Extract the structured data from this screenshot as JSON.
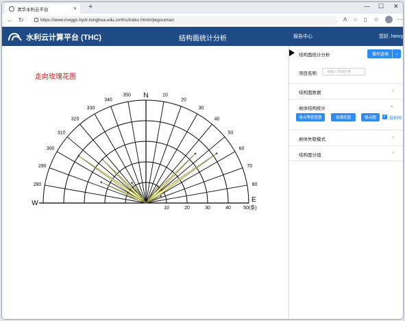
{
  "browser": {
    "tab_title": "清华水利云平台",
    "url": "https://www.meggs.hydr.tsinghua.edu.cn/thc/index.html#/jiegoumian"
  },
  "header": {
    "brand": "水利云计算平台 (THC)",
    "page_title": "结构面统计分析",
    "report_center": "报告中心",
    "greeting": "您好, henry"
  },
  "chart_data": {
    "type": "rose",
    "title": "走向玫瑰花图",
    "north_label": "N",
    "west_label": "W",
    "east_label": "E",
    "angle_ticks": [
      "280",
      "290",
      "300",
      "310",
      "320",
      "330",
      "340",
      "350",
      "10",
      "20",
      "30",
      "40",
      "50",
      "60",
      "70",
      "80"
    ],
    "radial_ticks": [
      "10",
      "20",
      "30",
      "40"
    ],
    "radial_max_label": "50(条)",
    "radial_max": 50,
    "petals": [
      {
        "from_deg": 50,
        "to_deg": 60,
        "count": 42
      },
      {
        "from_deg": 40,
        "to_deg": 50,
        "count": 34
      },
      {
        "from_deg": 30,
        "to_deg": 40,
        "count": 10
      },
      {
        "from_deg": 60,
        "to_deg": 70,
        "count": 8
      },
      {
        "from_deg": 300,
        "to_deg": 310,
        "count": 40
      },
      {
        "from_deg": 310,
        "to_deg": 320,
        "count": 30
      },
      {
        "from_deg": 290,
        "to_deg": 300,
        "count": 24
      },
      {
        "from_deg": 320,
        "to_deg": 330,
        "count": 12
      }
    ],
    "petal_color": "#fbf7a0",
    "petal_stroke": "#7d7d3a"
  },
  "panel": {
    "title": "结构面统计分析",
    "operations_label": "操作选项",
    "project_label": "项目名称:",
    "project_placeholder": "请输入项目名称",
    "sections": [
      {
        "label": "结构面数据"
      },
      {
        "label": "岩体结构统计"
      },
      {
        "label": "岩体失稳模式"
      },
      {
        "label": "结构面分组"
      }
    ],
    "stat_buttons": [
      "极点等密度图",
      "玫瑰花图",
      "极点图"
    ],
    "projection_label": "投影网"
  }
}
